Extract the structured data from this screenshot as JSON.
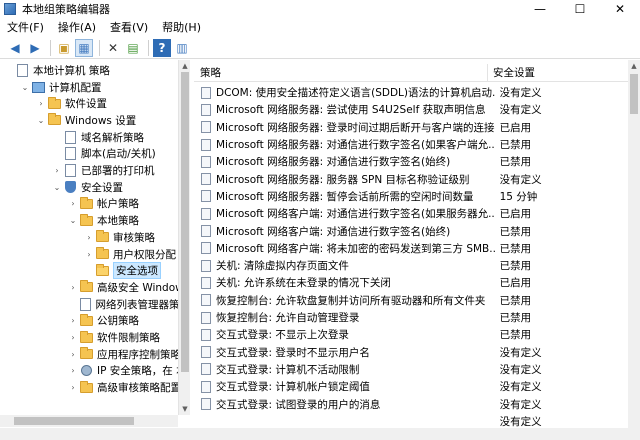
{
  "window": {
    "title": "本地组策略编辑器"
  },
  "window_controls": {
    "minimize": "—",
    "maximize": "☐",
    "close": "✕"
  },
  "menu": [
    "文件(F)",
    "操作(A)",
    "查看(V)",
    "帮助(H)"
  ],
  "toolbar": {
    "icons": [
      "back-arrow-icon",
      "forward-arrow-icon",
      "folder-up-icon",
      "show-hide-tree-icon",
      "delete-icon",
      "export-list-icon",
      "help-icon",
      "properties-icon"
    ],
    "glyphs": [
      "◀",
      "▶",
      "▣",
      "▦",
      "✕",
      "▤",
      "?",
      "▥"
    ]
  },
  "tree": [
    {
      "label": "本地计算机 策略",
      "depth": 0,
      "icon": "doc",
      "expander": ""
    },
    {
      "label": "计算机配置",
      "depth": 1,
      "icon": "pc",
      "expander": "v"
    },
    {
      "label": "软件设置",
      "depth": 2,
      "icon": "folder",
      "expander": ">"
    },
    {
      "label": "Windows 设置",
      "depth": 2,
      "icon": "folder",
      "expander": "v"
    },
    {
      "label": "域名解析策略",
      "depth": 3,
      "icon": "doc",
      "expander": ""
    },
    {
      "label": "脚本(启动/关机)",
      "depth": 3,
      "icon": "doc",
      "expander": ""
    },
    {
      "label": "已部署的打印机",
      "depth": 3,
      "icon": "doc",
      "expander": ">"
    },
    {
      "label": "安全设置",
      "depth": 3,
      "icon": "shield",
      "expander": "v"
    },
    {
      "label": "帐户策略",
      "depth": 4,
      "icon": "folder",
      "expander": ">"
    },
    {
      "label": "本地策略",
      "depth": 4,
      "icon": "folder",
      "expander": "v"
    },
    {
      "label": "审核策略",
      "depth": 5,
      "icon": "folder",
      "expander": ">"
    },
    {
      "label": "用户权限分配",
      "depth": 5,
      "icon": "folder",
      "expander": ">"
    },
    {
      "label": "安全选项",
      "depth": 5,
      "icon": "folder-open",
      "expander": "",
      "selected": true
    },
    {
      "label": "高级安全 Windows",
      "depth": 4,
      "icon": "folder",
      "expander": ">"
    },
    {
      "label": "网络列表管理器策略",
      "depth": 4,
      "icon": "doc",
      "expander": ""
    },
    {
      "label": "公钥策略",
      "depth": 4,
      "icon": "folder",
      "expander": ">"
    },
    {
      "label": "软件限制策略",
      "depth": 4,
      "icon": "folder",
      "expander": ">"
    },
    {
      "label": "应用程序控制策略",
      "depth": 4,
      "icon": "folder",
      "expander": ">"
    },
    {
      "label": "IP 安全策略，在 本",
      "depth": 4,
      "icon": "gear",
      "expander": ">"
    },
    {
      "label": "高级审核策略配置",
      "depth": 4,
      "icon": "folder",
      "expander": ">"
    }
  ],
  "list": {
    "columns": {
      "policy": "策略",
      "setting": "安全设置"
    },
    "rows": [
      {
        "policy": "DCOM: 使用安全描述符定义语言(SDDL)语法的计算机启动...",
        "setting": "没有定义"
      },
      {
        "policy": "Microsoft 网络服务器: 尝试使用 S4U2Self 获取声明信息",
        "setting": "没有定义"
      },
      {
        "policy": "Microsoft 网络服务器: 登录时间过期后断开与客户端的连接",
        "setting": "已启用"
      },
      {
        "policy": "Microsoft 网络服务器: 对通信进行数字签名(如果客户端允...",
        "setting": "已禁用"
      },
      {
        "policy": "Microsoft 网络服务器: 对通信进行数字签名(始终)",
        "setting": "已禁用"
      },
      {
        "policy": "Microsoft 网络服务器: 服务器 SPN 目标名称验证级别",
        "setting": "没有定义"
      },
      {
        "policy": "Microsoft 网络服务器: 暂停会话前所需的空闲时间数量",
        "setting": "15 分钟"
      },
      {
        "policy": "Microsoft 网络客户端: 对通信进行数字签名(如果服务器允...",
        "setting": "已启用"
      },
      {
        "policy": "Microsoft 网络客户端: 对通信进行数字签名(始终)",
        "setting": "已禁用"
      },
      {
        "policy": "Microsoft 网络客户端: 将未加密的密码发送到第三方 SMB...",
        "setting": "已禁用"
      },
      {
        "policy": "关机: 清除虚拟内存页面文件",
        "setting": "已禁用"
      },
      {
        "policy": "关机: 允许系统在未登录的情况下关闭",
        "setting": "已启用"
      },
      {
        "policy": "恢复控制台: 允许软盘复制并访问所有驱动器和所有文件夹",
        "setting": "已禁用"
      },
      {
        "policy": "恢复控制台: 允许自动管理登录",
        "setting": "已禁用"
      },
      {
        "policy": "交互式登录: 不显示上次登录",
        "setting": "已禁用"
      },
      {
        "policy": "交互式登录: 登录时不显示用户名",
        "setting": "没有定义"
      },
      {
        "policy": "交互式登录: 计算机不活动限制",
        "setting": "没有定义"
      },
      {
        "policy": "交互式登录: 计算机帐户锁定阈值",
        "setting": "没有定义"
      },
      {
        "policy": "交互式登录: 试图登录的用户的消息",
        "setting": "没有定义"
      },
      {
        "policy": "",
        "setting": "没有定义"
      },
      {
        "policy": "",
        "setting": "没有定义"
      }
    ]
  }
}
